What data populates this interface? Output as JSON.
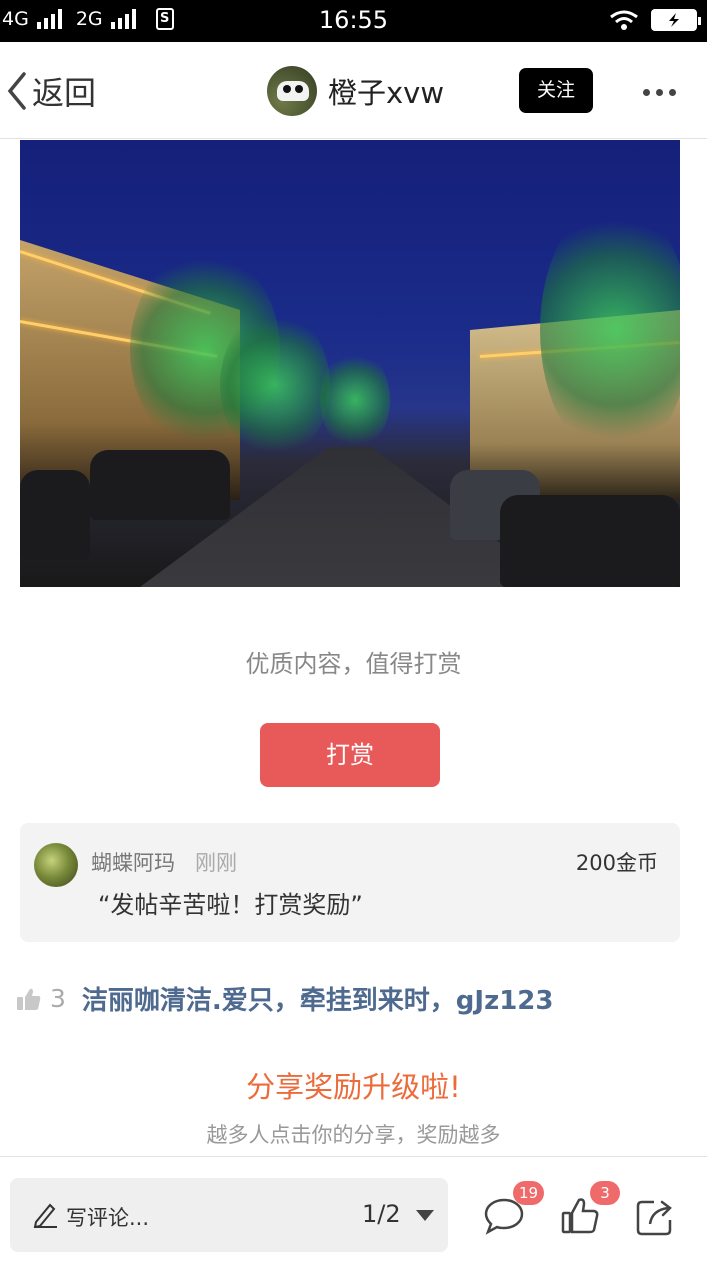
{
  "status_bar": {
    "network1": "4G",
    "network2": "2G",
    "time": "16:55"
  },
  "header": {
    "back_label": "返回",
    "username": "橙子xvw",
    "follow_label": "关注"
  },
  "reward": {
    "prompt": "优质内容，值得打赏",
    "button_label": "打赏"
  },
  "tip": {
    "user": "蝴蝶阿玛",
    "time": "刚刚",
    "amount": "200金币",
    "message": "“发帖辛苦啦！打赏奖励”"
  },
  "likes": {
    "count": "3",
    "names": "洁丽咖清洁.爱只，牵挂到来时，gJz123"
  },
  "share": {
    "title": "分享奖励升级啦!",
    "subtitle": "越多人点击你的分享，奖励越多"
  },
  "bottom": {
    "comment_placeholder": "写评论...",
    "page_indicator": "1/2",
    "comment_badge": "19",
    "like_badge": "3"
  },
  "colors": {
    "accent_red": "#e85a5a",
    "share_orange": "#ec6b3a",
    "link_blue": "#4f6a8f"
  }
}
